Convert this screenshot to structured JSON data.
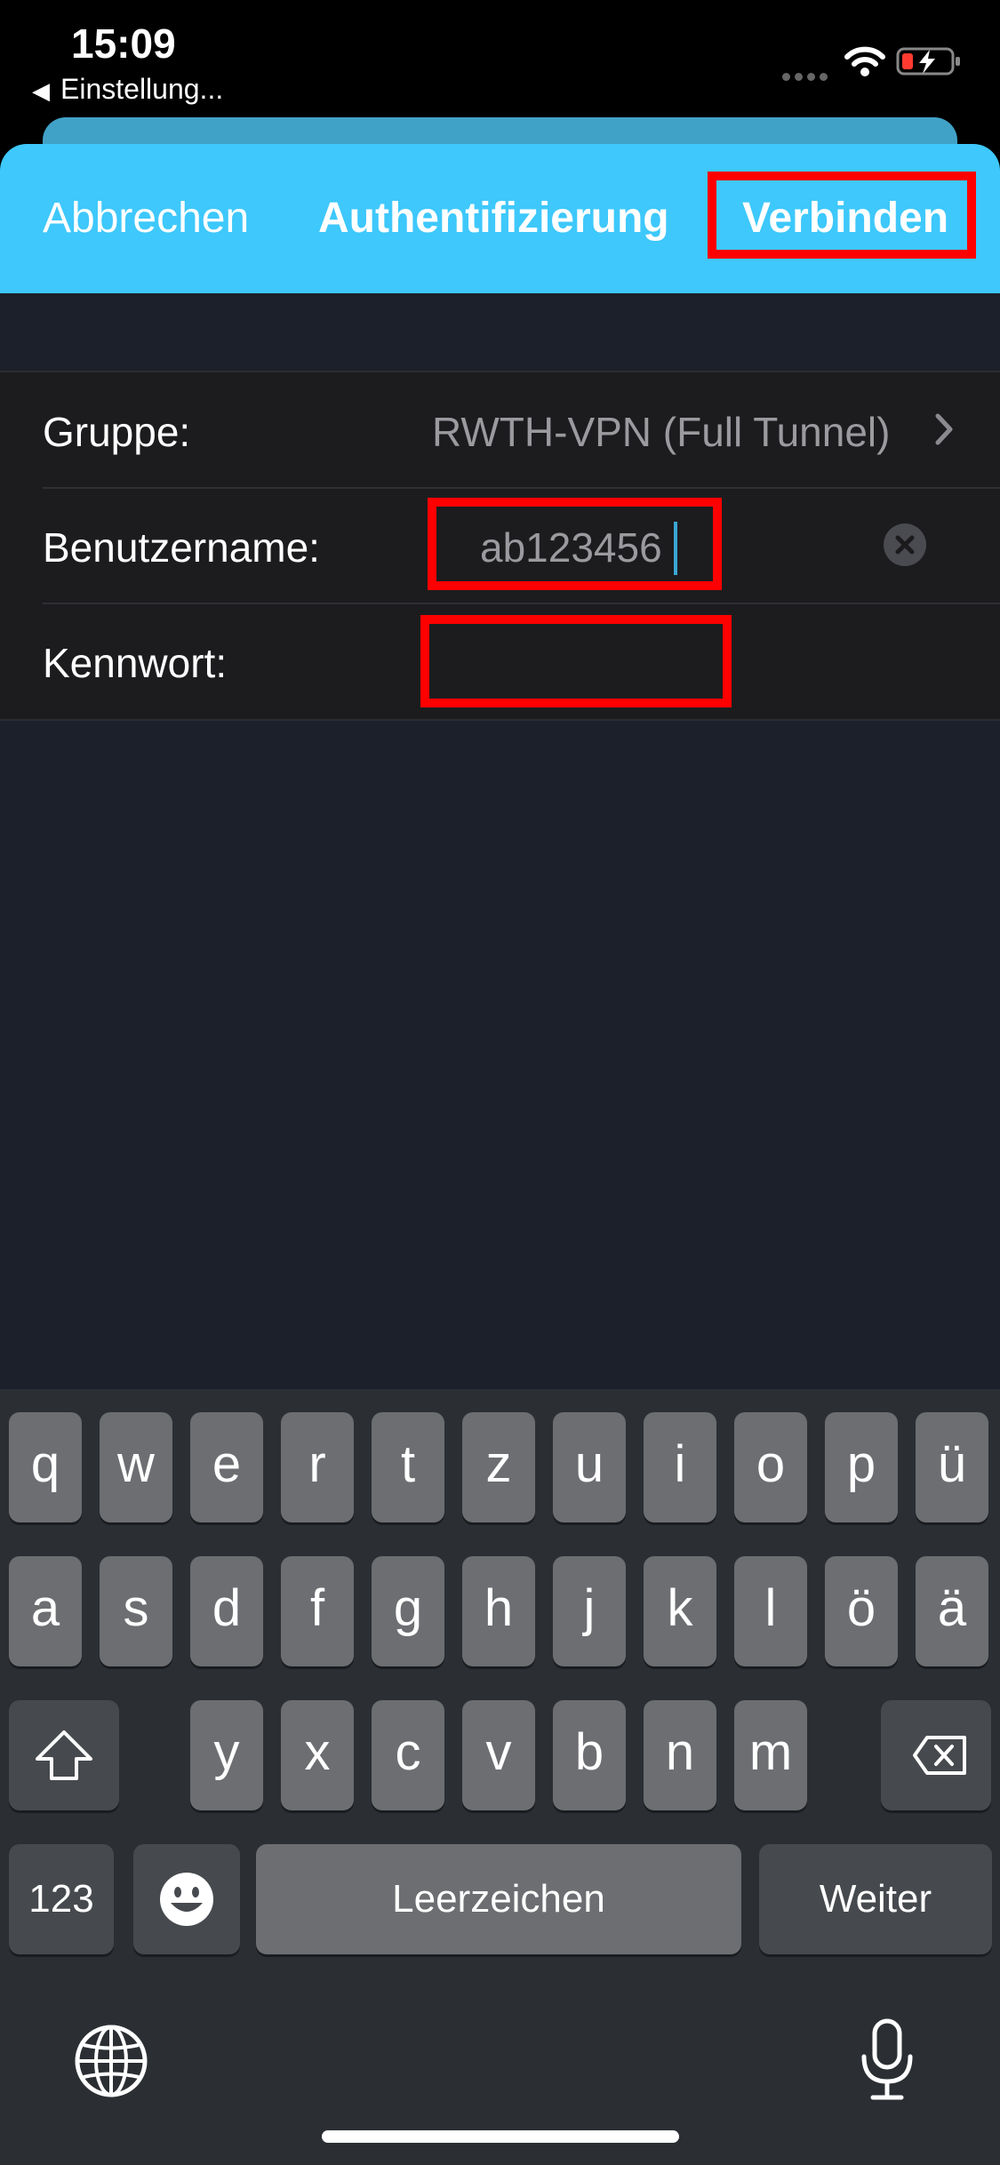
{
  "status_bar": {
    "time": "15:09",
    "back_app": "Einstellung...",
    "icons": [
      "cellular-dots-icon",
      "wifi-icon",
      "battery-charging-icon"
    ]
  },
  "header": {
    "cancel_label": "Abbrechen",
    "title": "Authentifizierung",
    "connect_label": "Verbinden",
    "background_color": "#3ec8fb",
    "highlight_color": "#ff0000"
  },
  "form": {
    "group_label": "Gruppe:",
    "group_value": "RWTH-VPN (Full Tunnel)",
    "username_label": "Benutzername:",
    "username_value": "ab123456",
    "password_label": "Kennwort:",
    "password_value": ""
  },
  "keyboard": {
    "row1": [
      "q",
      "w",
      "e",
      "r",
      "t",
      "z",
      "u",
      "i",
      "o",
      "p",
      "ü"
    ],
    "row2": [
      "a",
      "s",
      "d",
      "f",
      "g",
      "h",
      "j",
      "k",
      "l",
      "ö",
      "ä"
    ],
    "row3": [
      "y",
      "x",
      "c",
      "v",
      "b",
      "n",
      "m"
    ],
    "numbers_label": "123",
    "space_label": "Leerzeichen",
    "return_label": "Weiter",
    "icons": [
      "shift-icon",
      "backspace-icon",
      "emoji-icon",
      "globe-icon",
      "microphone-icon"
    ]
  }
}
